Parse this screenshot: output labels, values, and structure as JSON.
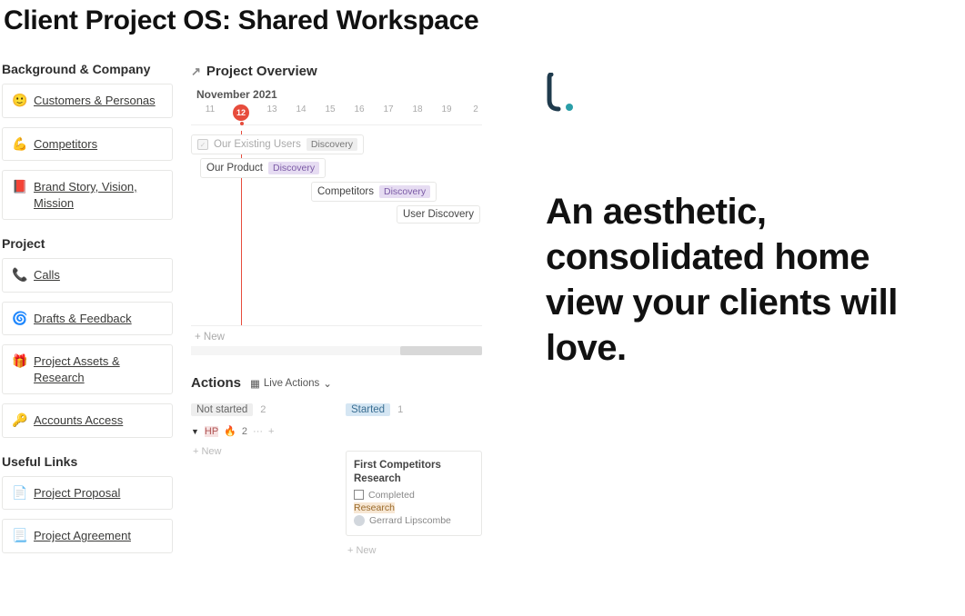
{
  "page_title": "Client Project OS: Shared Workspace",
  "sidebar": {
    "groups": [
      {
        "label": "Background & Company",
        "items": [
          {
            "icon": "🙂",
            "label": "Customers & Personas"
          },
          {
            "icon": "💪",
            "label": "Competitors"
          },
          {
            "icon": "📕",
            "label": "Brand Story, Vision, Mission"
          }
        ]
      },
      {
        "label": "Project",
        "items": [
          {
            "icon": "📞",
            "label": "Calls"
          },
          {
            "icon": "🌀",
            "label": "Drafts & Feedback"
          },
          {
            "icon": "🎁",
            "label": "Project Assets & Research"
          },
          {
            "icon": "🔑",
            "label": "Accounts Access"
          }
        ]
      },
      {
        "label": "Useful Links",
        "items": [
          {
            "icon": "📄",
            "label": "Project Proposal"
          },
          {
            "icon": "📃",
            "label": "Project Agreement"
          }
        ]
      }
    ]
  },
  "overview": {
    "heading": "Project Overview",
    "month": "November 2021",
    "dates": [
      "11",
      "12",
      "13",
      "14",
      "15",
      "16",
      "17",
      "18",
      "19",
      "2"
    ],
    "today": "12",
    "bars": [
      {
        "title": "Our Existing Users",
        "status": "Discovery",
        "done": true
      },
      {
        "title": "Our Product",
        "status": "Discovery"
      },
      {
        "title": "Competitors",
        "status": "Discovery"
      },
      {
        "title": "User Discovery"
      }
    ],
    "new_label": "+  New"
  },
  "actions": {
    "heading": "Actions",
    "view_label": "Live Actions",
    "kanban": {
      "columns": [
        {
          "status": "Not started",
          "status_style": "grey",
          "count": "2"
        },
        {
          "status": "Started",
          "status_style": "blue",
          "count": "1"
        }
      ],
      "subgroup": {
        "label": "HP",
        "emoji": "🔥",
        "count": "2"
      },
      "card": {
        "title": "First Competitors Research",
        "prop_completed": "Completed",
        "tag": "Research",
        "assignee": "Gerrard Lipscombe"
      },
      "new_label": "+  New"
    }
  },
  "hero": {
    "headline": "An aesthetic, consolidated home view your clients will love."
  }
}
